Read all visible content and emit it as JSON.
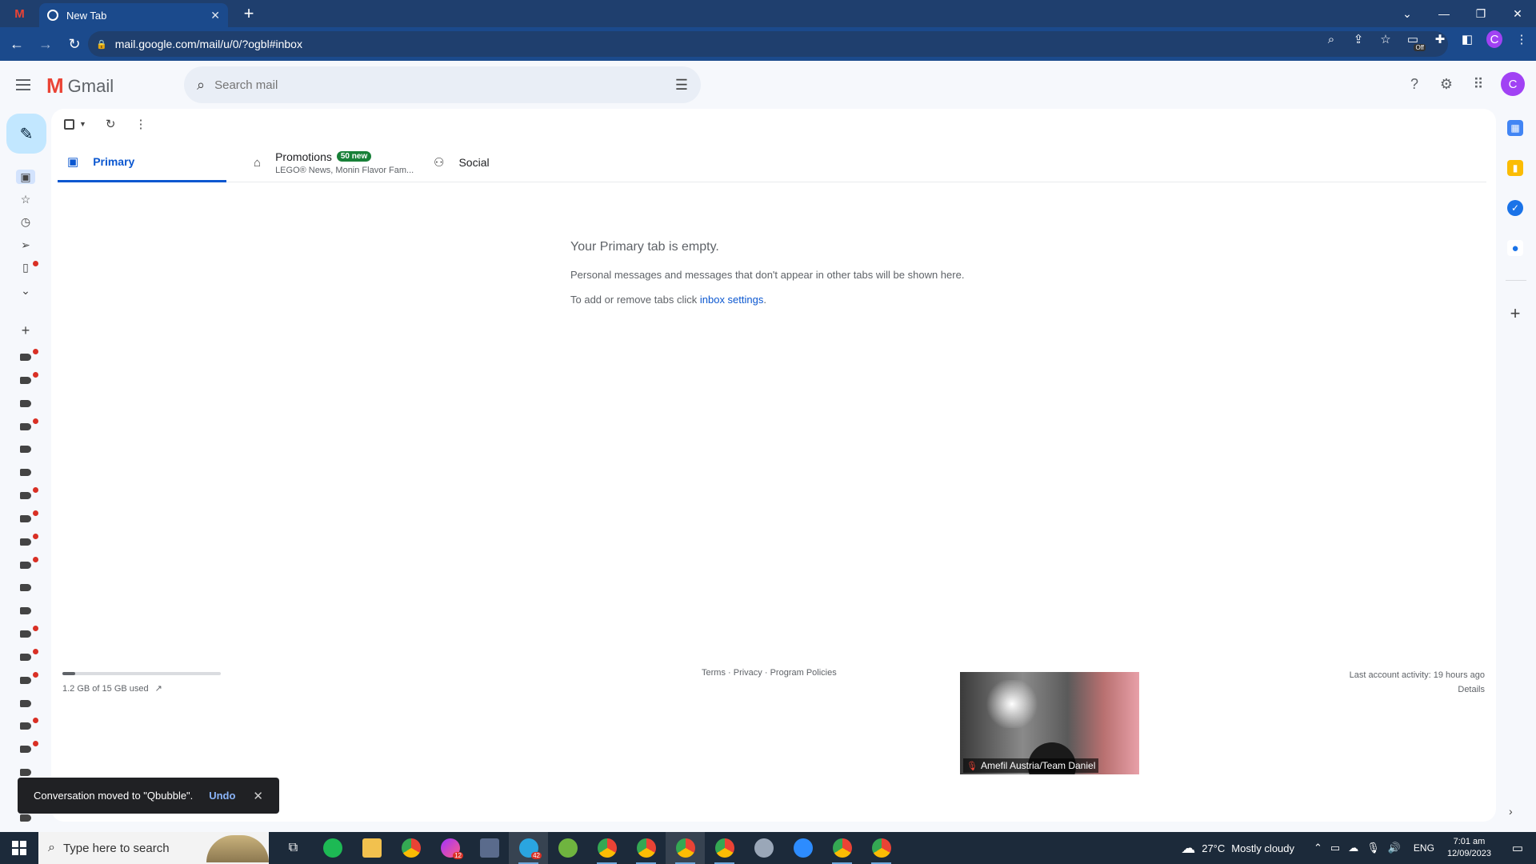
{
  "browser": {
    "tab_title": "New Tab",
    "url": "mail.google.com/mail/u/0/?ogbl#inbox",
    "profile_initial": "C",
    "extension_badge": "Off"
  },
  "gmail": {
    "app_name": "Gmail",
    "search_placeholder": "Search mail",
    "avatar_initial": "C",
    "tabs": [
      {
        "label": "Primary",
        "icon": "inbox-icon"
      },
      {
        "label": "Promotions",
        "badge": "50 new",
        "snippet": "LEGO® News, Monin Flavor Fam...",
        "icon": "tag-icon"
      },
      {
        "label": "Social",
        "icon": "people-icon"
      }
    ],
    "empty": {
      "title": "Your Primary tab is empty.",
      "line1": "Personal messages and messages that don't appear in other tabs will be shown here.",
      "line2_prefix": "To add or remove tabs click ",
      "line2_link": "inbox settings",
      "line2_suffix": "."
    },
    "storage": {
      "text": "1.2 GB of 15 GB used",
      "fraction": 0.08
    },
    "footer": {
      "terms": "Terms",
      "privacy": "Privacy",
      "policies": "Program Policies",
      "sep": " · "
    },
    "activity": {
      "text": "Last account activity: 19 hours ago",
      "details": "Details"
    },
    "snackbar": {
      "message": "Conversation moved to \"Qbubble\".",
      "action": "Undo"
    }
  },
  "video": {
    "name": "Amefil Austria/Team Daniel"
  },
  "taskbar": {
    "search_placeholder": "Type here to search",
    "weather": {
      "temp": "27°C",
      "condition": "Mostly cloudy"
    },
    "language": "ENG",
    "time": "7:01 am",
    "date": "12/09/2023",
    "telegram_badge": "42",
    "messenger_badge": "12"
  },
  "colors": {
    "accent": "#0b57d0",
    "chrome_tab": "#1b4a8c",
    "promo_badge": "#188038",
    "label_dot": "#d93025"
  }
}
